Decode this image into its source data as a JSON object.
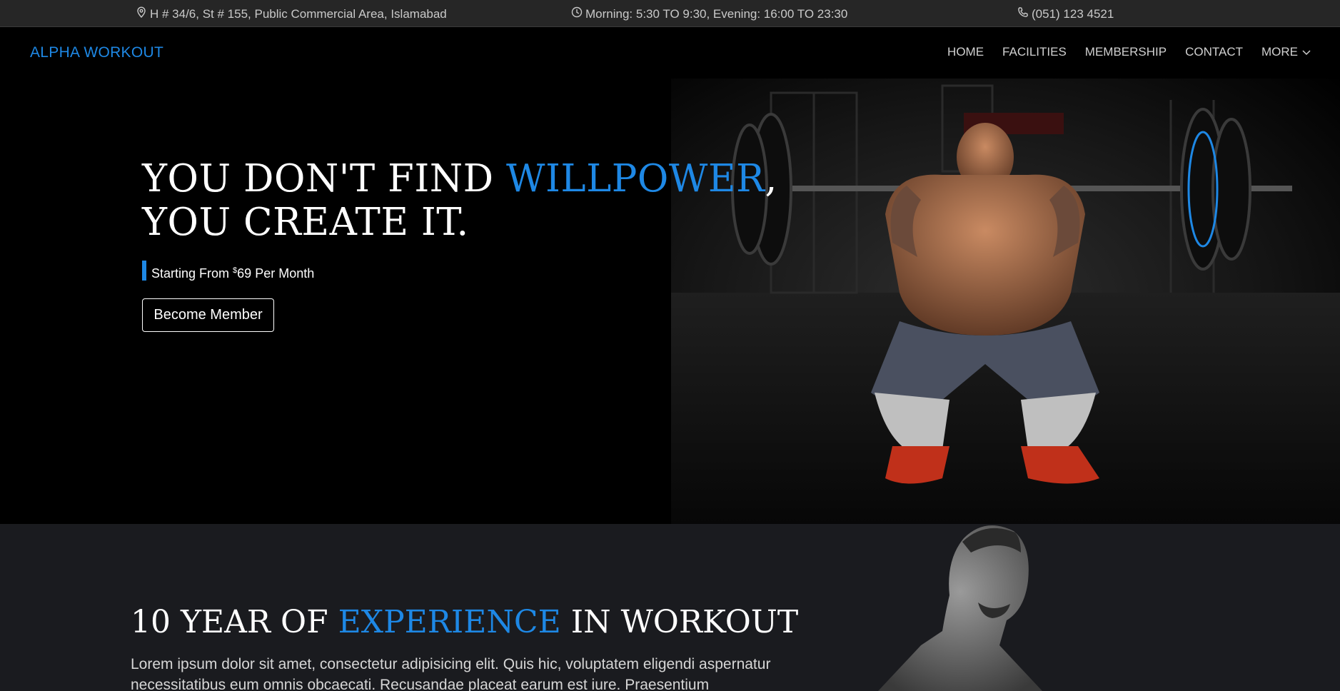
{
  "topbar": {
    "address": "H # 34/6, St # 155, Public Commercial Area, Islamabad",
    "hours": "Morning: 5:30 TO 9:30, Evening: 16:00 TO 23:30",
    "phone": "(051) 123 4521",
    "icons": [
      "map-pin-icon",
      "clock-icon",
      "phone-icon"
    ]
  },
  "navbar": {
    "brand": "ALPHA WORKOUT",
    "items": [
      {
        "label": "HOME"
      },
      {
        "label": "FACILITIES"
      },
      {
        "label": "MEMBERSHIP"
      },
      {
        "label": "CONTACT"
      },
      {
        "label": "MORE"
      }
    ]
  },
  "hero": {
    "title_part1": "YOU DON'T FIND ",
    "title_accent": "WILLPOWER",
    "title_part2": ", YOU CREATE IT.",
    "price_prefix": "Starting From ",
    "price_currency": "$",
    "price_amount": "69",
    "price_suffix": " Per Month",
    "cta": "Become Member"
  },
  "about": {
    "title_part1": "10 YEAR OF ",
    "title_accent": "EXPERIENCE",
    "title_part2": " IN WORKOUT",
    "text": "Lorem ipsum dolor sit amet, consectetur adipisicing elit. Quis hic, voluptatem eligendi aspernatur necessitatibus eum omnis obcaecati. Recusandae placeat earum est iure. Praesentium"
  },
  "colors": {
    "accent": "#1e88e5",
    "topbar_bg": "#262626",
    "section_bg": "#1a1b1f"
  }
}
